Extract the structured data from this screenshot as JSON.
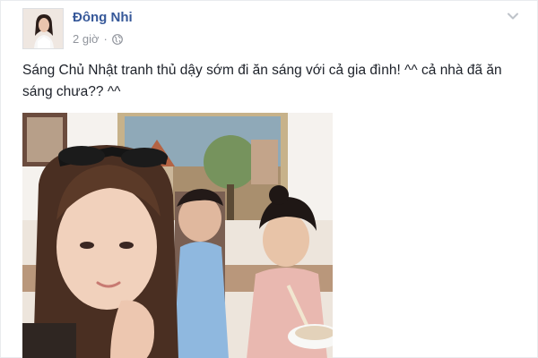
{
  "post": {
    "author": "Đông Nhi",
    "time": "2 giờ",
    "separator": "·",
    "text": "Sáng Chủ Nhật tranh thủ dậy sớm đi ăn sáng với cả gia đình! ^^ cả nhà đã ăn sáng chưa?? ^^",
    "privacy_icon": "globe-icon",
    "options_icon": "chevron-down-icon"
  },
  "colors": {
    "author_link": "#365899",
    "meta_text": "#90949c",
    "body_text": "#1d2129"
  }
}
